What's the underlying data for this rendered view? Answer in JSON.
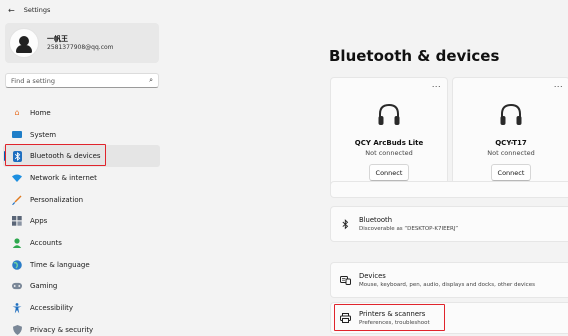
{
  "window": {
    "title": "Settings",
    "back_glyph": "←"
  },
  "profile": {
    "name": "一帆王",
    "email": "2581377908@qq.com"
  },
  "search": {
    "placeholder": "Find a setting",
    "icon": "search-icon"
  },
  "sidebar": {
    "items": [
      {
        "label": "Home",
        "icon": "home-icon",
        "glyph": "🏠",
        "color": "#e8742b"
      },
      {
        "label": "System",
        "icon": "system-icon",
        "glyph": "▬",
        "color": "#1f7ec8"
      },
      {
        "label": "Bluetooth & devices",
        "icon": "bluetooth-icon",
        "glyph": "ᛒ",
        "color": "#ffffff",
        "active": true
      },
      {
        "label": "Network & internet",
        "icon": "wifi-icon",
        "glyph": "◆",
        "color": "#1d8fe0"
      },
      {
        "label": "Personalization",
        "icon": "brush-icon",
        "glyph": "✎",
        "color": "#e07a1f"
      },
      {
        "label": "Apps",
        "icon": "apps-icon",
        "glyph": "▦",
        "color": "#5a6577"
      },
      {
        "label": "Accounts",
        "icon": "accounts-icon",
        "glyph": "●",
        "color": "#2fa84f"
      },
      {
        "label": "Time & language",
        "icon": "globe-icon",
        "glyph": "◍",
        "color": "#2a7cc7"
      },
      {
        "label": "Gaming",
        "icon": "gamepad-icon",
        "glyph": "◕",
        "color": "#7a8797"
      },
      {
        "label": "Accessibility",
        "icon": "accessibility-icon",
        "glyph": "✦",
        "color": "#1f6fc0"
      },
      {
        "label": "Privacy & security",
        "icon": "shield-icon",
        "glyph": "⛉",
        "color": "#7a8797"
      }
    ]
  },
  "main": {
    "title": "Bluetooth & devices",
    "devices": [
      {
        "name": "QCY ArcBuds Lite",
        "status": "Not connected",
        "button": "Connect",
        "more": "..."
      },
      {
        "name": "QCY-T17",
        "status": "Not connected",
        "button": "Connect",
        "more": "..."
      }
    ],
    "bluetooth": {
      "title": "Bluetooth",
      "subtitle": "Discoverable as “DESKTOP-K7IEERJ”",
      "icon": "bluetooth-icon"
    },
    "devices_row": {
      "title": "Devices",
      "subtitle": "Mouse, keyboard, pen, audio, displays and docks, other devices",
      "icon": "keyboard-icon"
    },
    "printers_row": {
      "title": "Printers & scanners",
      "subtitle": "Preferences, troubleshoot",
      "icon": "printer-icon"
    }
  },
  "colors": {
    "accent": "#005fb8",
    "highlight": "#e0242c",
    "background": "#f3f3f3"
  }
}
